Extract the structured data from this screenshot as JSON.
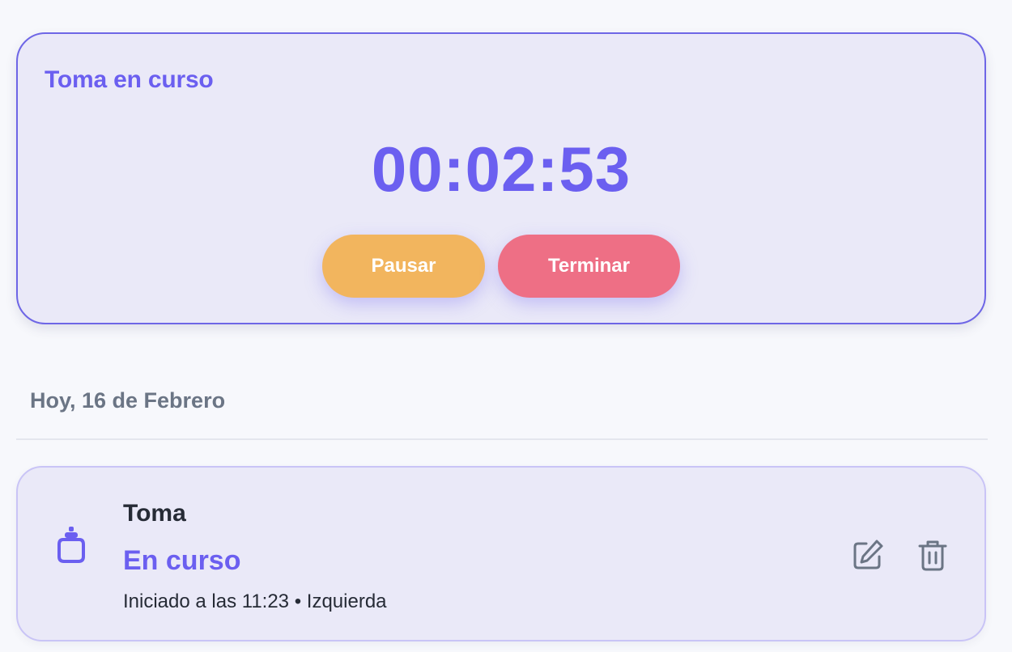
{
  "active_session": {
    "title": "Toma en curso",
    "timer": "00:02:53",
    "pause_label": "Pausar",
    "stop_label": "Terminar"
  },
  "history": {
    "date_heading": "Hoy, 16 de Febrero",
    "entries": [
      {
        "icon": "bottle-icon",
        "title": "Toma",
        "status": "En curso",
        "started_at": "Iniciado a las 11:23",
        "separator": "•",
        "side": "Izquierda",
        "actions": [
          "edit-icon",
          "trash-icon"
        ]
      }
    ]
  },
  "colors": {
    "accent": "#6b5ff0",
    "pause": "#f2b55e",
    "stop": "#ee6f85",
    "card_bg": "#eae9f8",
    "page_bg": "#f7f8fc",
    "muted_text": "#6b7585",
    "icon_gray": "#6b7585"
  }
}
